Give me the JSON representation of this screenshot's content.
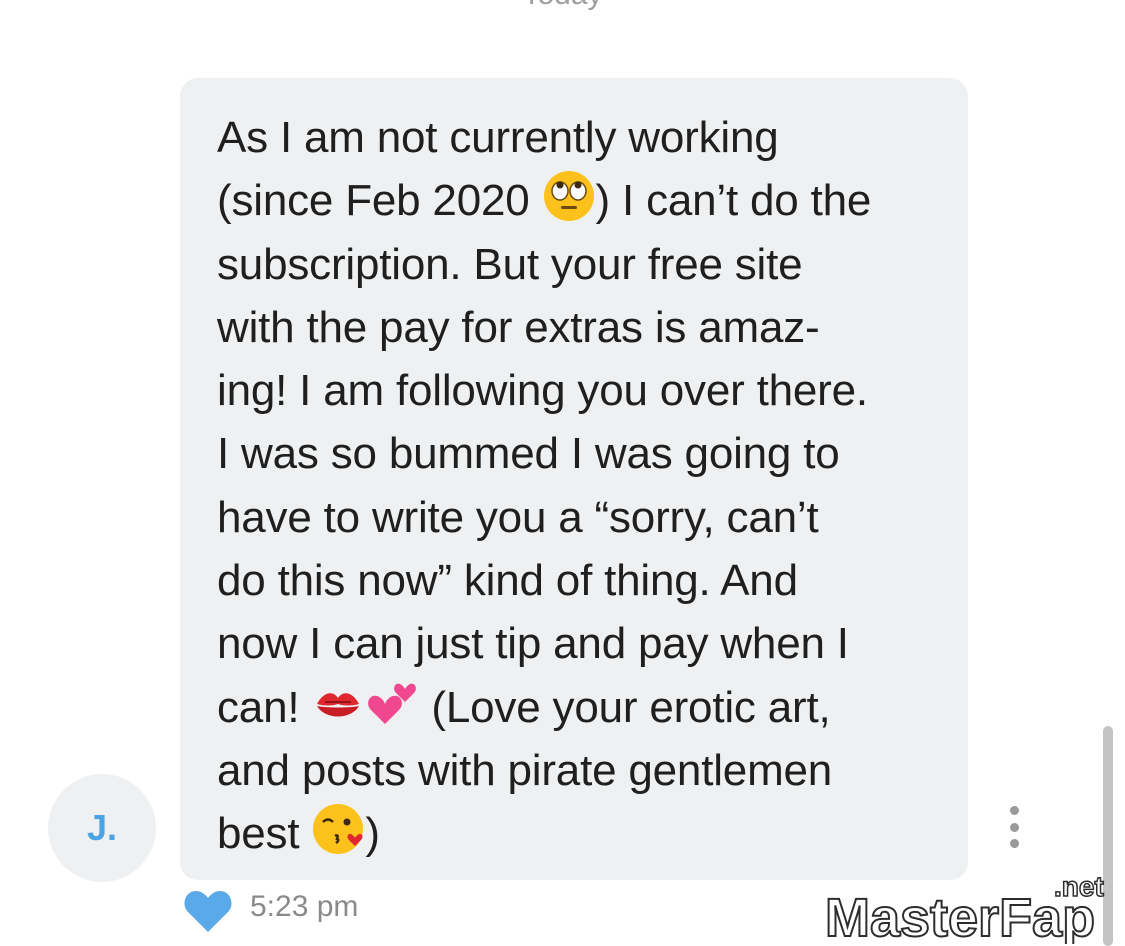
{
  "header": {
    "day_label": "Today"
  },
  "contact": {
    "initial": "J."
  },
  "message": {
    "lines": [
      "As I am not currently working",
      "(since Feb 2020 ",
      ") I can’t do the",
      "subscription. But your free site",
      "with the pay for extras is amaz-",
      "ing! I am following you over there.",
      "I was so bummed I was going to",
      "have to write you a “sorry, can’t",
      "do this now” kind of thing. And",
      "now I can just tip and pay when I",
      "can! ",
      " (Love your erotic art,",
      "and posts with pirate gentlemen",
      "best ",
      ")"
    ],
    "time": "5:23 pm",
    "liked": true
  },
  "icons": {
    "emoji_1": "face-with-rolling-eyes",
    "emoji_2": "kiss-mark",
    "emoji_3": "two-hearts",
    "emoji_4": "face-blowing-a-kiss",
    "reaction": "heart-icon",
    "menu": "more-vertical-icon"
  },
  "watermark": {
    "brand": "MasterFap",
    "suffix": ".net"
  },
  "colors": {
    "bubble": "#eef0f1",
    "accent": "#4ba3e3",
    "text": "#1f1f1f",
    "meta": "#8a8a8a"
  }
}
